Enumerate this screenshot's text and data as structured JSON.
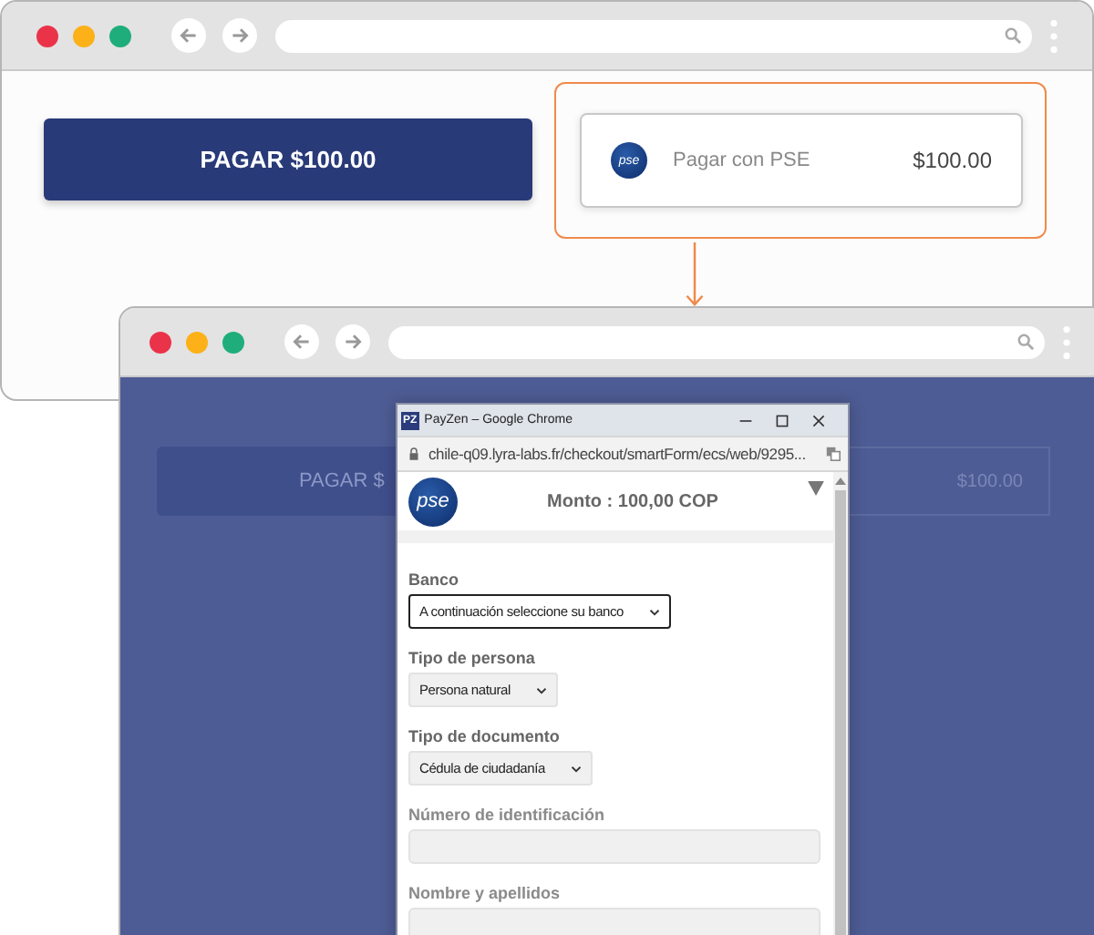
{
  "main_window": {
    "pay_button": "PAGAR $100.00",
    "payment_option": {
      "logo": "pse",
      "label": "Pagar con PSE",
      "amount": "$100.00"
    }
  },
  "second_window": {
    "background_button": "PAGAR $",
    "background_amount": "$100.00"
  },
  "popup": {
    "app_icon": "PZ",
    "title": "PayZen – Google Chrome",
    "url": "chile-q09.lyra-labs.fr/checkout/smartForm/ecs/web/9295...",
    "logo": "pse",
    "amount": "Monto : 100,00 COP",
    "fields": [
      {
        "kind": "select",
        "label": "Banco",
        "value": "A continuación seleccione su banco",
        "focused": true
      },
      {
        "kind": "select",
        "label": "Tipo de persona",
        "value": "Persona natural",
        "focused": false
      },
      {
        "kind": "select",
        "label": "Tipo de documento",
        "value": "Cédula de ciudadanía",
        "focused": false
      },
      {
        "kind": "text",
        "label": "Número de identificación",
        "focused": false
      },
      {
        "kind": "text",
        "label": "Nombre y apellidos",
        "focused": false
      }
    ]
  }
}
